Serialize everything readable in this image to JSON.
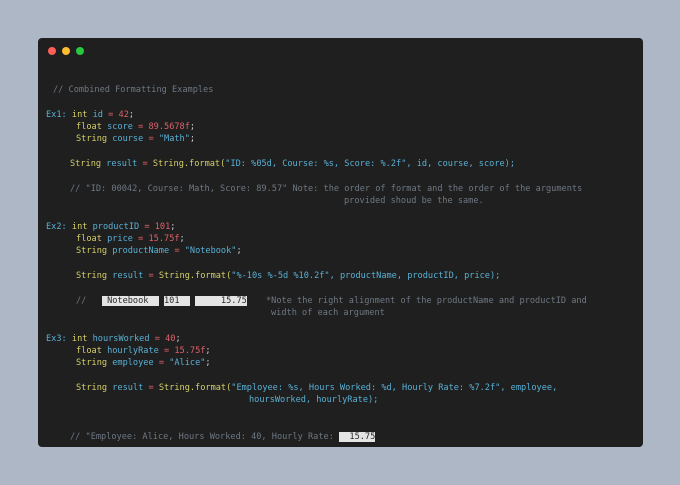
{
  "window": {
    "controls": {
      "close_color": "#ff5f57",
      "minimize_color": "#febc2e",
      "maximize_color": "#28c840"
    }
  },
  "theme": {
    "keyword": "#d6cf6a",
    "string": "#5ab0d6",
    "number": "#e0616b",
    "comment": "#6f7883",
    "text": "#c8d0d8"
  },
  "code": {
    "header_comment": "// Combined Formatting Examples",
    "ex1": {
      "label": "Ex1:",
      "l1_type": "int",
      "l1_var": "id",
      "l1_val": "42",
      "l2_type": "float",
      "l2_var": "score",
      "l2_val": "89.5678f",
      "l3_type": "String",
      "l3_var": "course",
      "l3_val": "\"Math\"",
      "result_type": "String",
      "result_var": "result",
      "result_call": "String.format(",
      "format_str": "\"ID: %05d, Course: %s, Score: %.2f\"",
      "args": ", id, course, score);",
      "out_comment": "// \"ID: 00042, Course: Math, Score: 89.57\" Note: the order of format and the order of the arguments",
      "out_comment_2": "provided shoud be the same."
    },
    "ex2": {
      "label": "Ex2:",
      "l1_type": "int",
      "l1_var": "productID",
      "l1_val": "101",
      "l2_type": "float",
      "l2_var": "price",
      "l2_val": "15.75f",
      "l3_type": "String",
      "l3_var": "productName",
      "l3_val": "\"Notebook\"",
      "result_type": "String",
      "result_var": "result",
      "result_call": "String.format(",
      "format_str": "\"%-10s %-5d %10.2f\"",
      "args": ", productName, productID, price);",
      "out_prefix": "//",
      "out_name": " Notebook  ",
      "out_id": "101  ",
      "out_price": "     15.75",
      "note_1": "*Note the right alignment of the productName and productID and",
      "note_2": "width of each argument"
    },
    "ex3": {
      "label": "Ex3:",
      "l1_type": "int",
      "l1_var": "hoursWorked",
      "l1_val": "40",
      "l2_type": "float",
      "l2_var": "hourlyRate",
      "l2_val": "15.75f",
      "l3_type": "String",
      "l3_var": "employee",
      "l3_val": "\"Alice\"",
      "result_type": "String",
      "result_var": "result",
      "result_call": "String.format(",
      "format_str": "\"Employee: %s, Hours Worked: %d, Hourly Rate: %7.2f\"",
      "args": ", employee,",
      "args_2": "hoursWorked, hourlyRate);",
      "out_comment": "// \"Employee: Alice, Hours Worked: 40, Hourly Rate:",
      "out_rate": "  15.75"
    }
  }
}
